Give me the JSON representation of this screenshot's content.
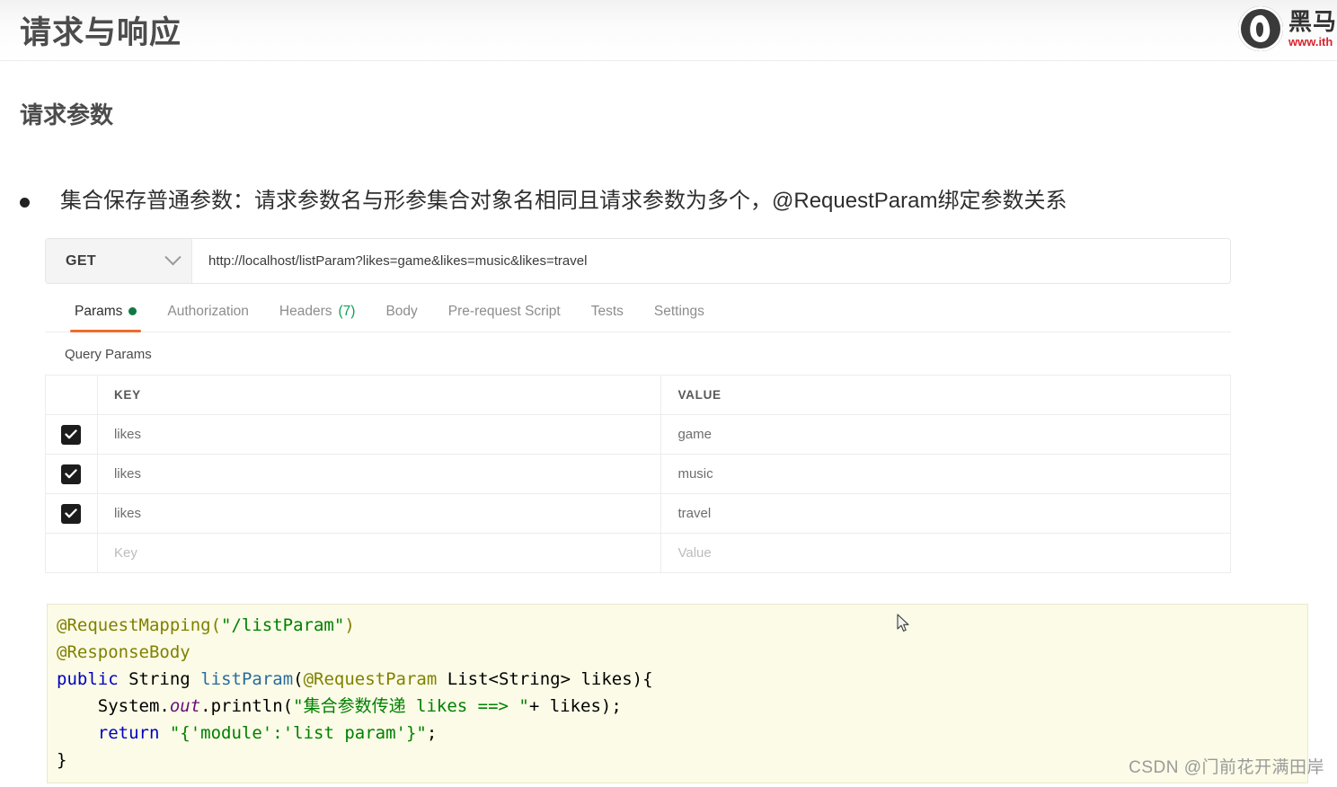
{
  "header": {
    "title": "请求与响应",
    "logo": {
      "cn": "黑马",
      "url": "www.ith"
    }
  },
  "section": {
    "heading": "请求参数"
  },
  "bullet": {
    "text": "集合保存普通参数：请求参数名与形参集合对象名相同且请求参数为多个，@RequestParam绑定参数关系"
  },
  "postman": {
    "method": "GET",
    "url": "http://localhost/listParam?likes=game&likes=music&likes=travel",
    "tabs": [
      {
        "label": "Params",
        "badge_dot": true,
        "active": true
      },
      {
        "label": "Authorization",
        "active": false
      },
      {
        "label": "Headers",
        "count": "(7)",
        "active": false
      },
      {
        "label": "Body",
        "active": false
      },
      {
        "label": "Pre-request Script",
        "active": false
      },
      {
        "label": "Tests",
        "active": false
      },
      {
        "label": "Settings",
        "active": false
      }
    ],
    "query_params_label": "Query Params",
    "table": {
      "headers": {
        "key": "KEY",
        "value": "VALUE"
      },
      "rows": [
        {
          "checked": true,
          "key": "likes",
          "value": "game"
        },
        {
          "checked": true,
          "key": "likes",
          "value": "music"
        },
        {
          "checked": true,
          "key": "likes",
          "value": "travel"
        }
      ],
      "placeholder_row": {
        "key": "Key",
        "value": "Value"
      }
    }
  },
  "code": {
    "lines": [
      "@RequestMapping(\"/listParam\")",
      "@ResponseBody",
      "public String listParam(@RequestParam List<String> likes){",
      "    System.out.println(\"集合参数传递 likes ==> \"+ likes);",
      "    return \"{'module':'list param'}\";",
      "}"
    ]
  },
  "watermark": {
    "text": "CSDN @门前花开满田岸"
  },
  "colors": {
    "accent_orange": "#ef6c2e",
    "badge_green": "#0e7a42",
    "count_green": "#0e9f57",
    "logo_red": "#d8242e",
    "code_bg": "#fbfbe7",
    "annotation": "#808000",
    "string": "#008000",
    "keyword": "#0000c0"
  }
}
